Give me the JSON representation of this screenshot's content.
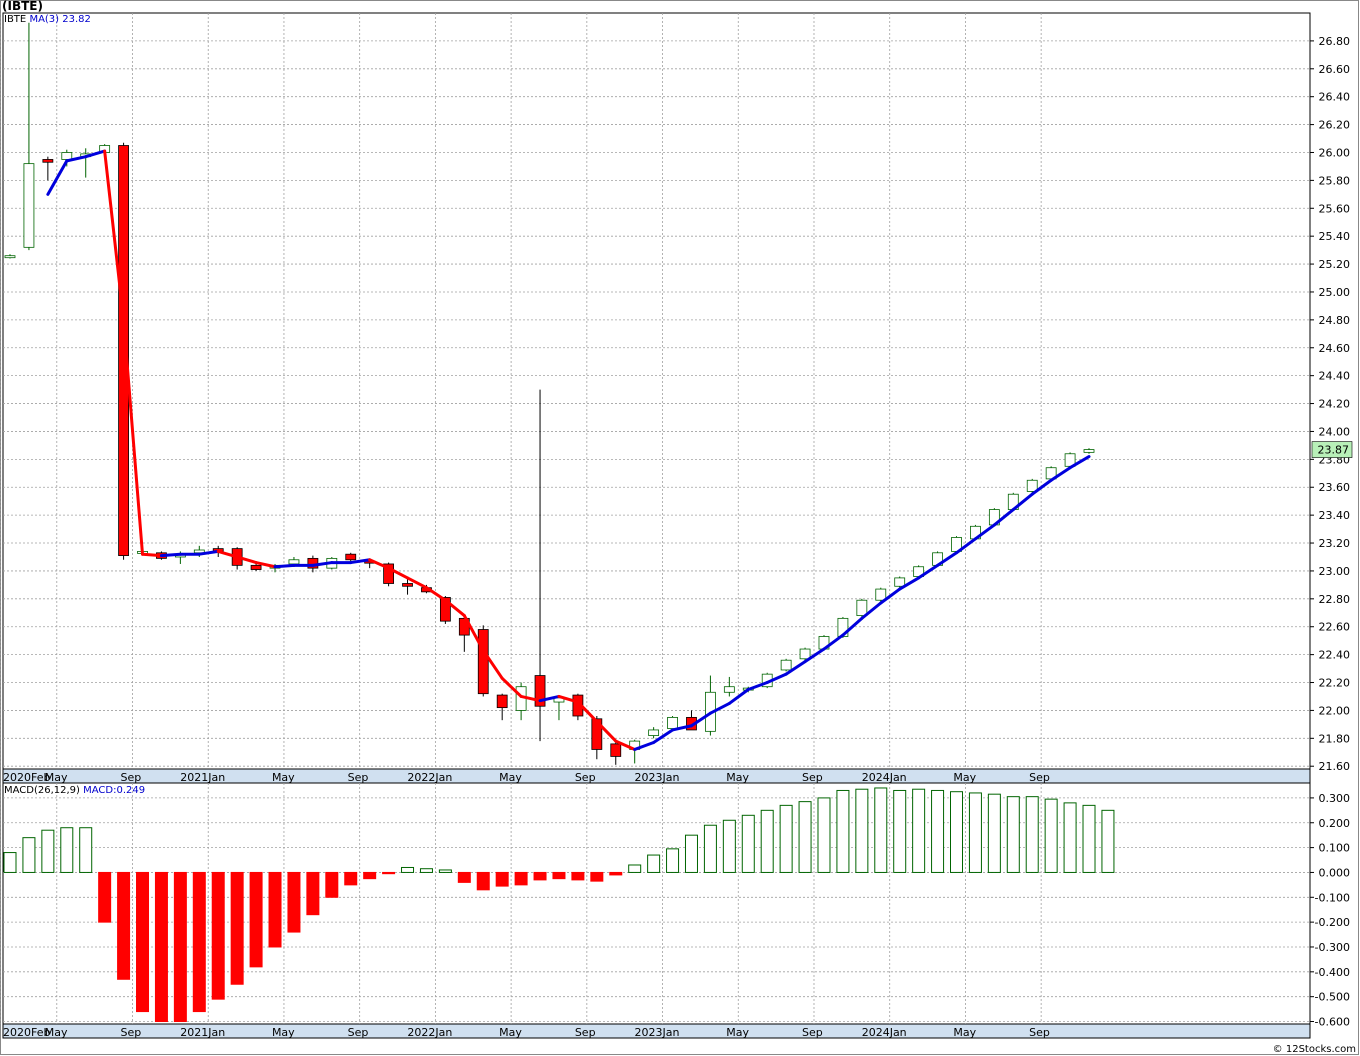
{
  "header": {
    "title": "(IBTE)"
  },
  "legend": {
    "price_ticker": "IBTE",
    "ma_label": "MA(3)",
    "ma_value": "23.82",
    "macd_params": "MACD(26,12,9)",
    "macd_value": "MACD:0.249"
  },
  "credit": "© 12Stocks.com",
  "colors": {
    "up": "#ffffff",
    "up_border": "#006400",
    "down": "#ff0000",
    "ma_up": "#0000dd",
    "ma_down": "#ff0000",
    "grid": "#a0a0a0",
    "axis_band": "#d0e0f0",
    "last_price_bg": "#b8f0b8"
  },
  "chart_data": [
    {
      "type": "candlestick",
      "title": "(IBTE)",
      "ylim": [
        21.58,
        27.0
      ],
      "y_ticks": [
        "21.60",
        "21.80",
        "22.00",
        "22.20",
        "22.40",
        "22.60",
        "22.80",
        "23.00",
        "23.20",
        "23.40",
        "23.60",
        "23.80",
        "24.00",
        "24.20",
        "24.40",
        "24.60",
        "24.80",
        "25.00",
        "25.20",
        "25.40",
        "25.60",
        "25.80",
        "26.00",
        "26.20",
        "26.40",
        "26.60",
        "26.80"
      ],
      "x_tick_labels": [
        "2020Feb",
        "May",
        "Sep",
        "2021Jan",
        "May",
        "Sep",
        "2022Jan",
        "May",
        "Sep",
        "2023Jan",
        "May",
        "Sep",
        "2024Jan",
        "May",
        "Sep"
      ],
      "last_price": "23.87",
      "candles": [
        {
          "o": 25.25,
          "h": 25.27,
          "l": 25.24,
          "c": 25.26
        },
        {
          "o": 25.32,
          "h": 26.93,
          "l": 25.3,
          "c": 25.92
        },
        {
          "o": 25.95,
          "h": 25.97,
          "l": 25.8,
          "c": 25.93
        },
        {
          "o": 25.95,
          "h": 26.02,
          "l": 25.9,
          "c": 26.0
        },
        {
          "o": 25.97,
          "h": 26.03,
          "l": 25.82,
          "c": 25.99
        },
        {
          "o": 26.0,
          "h": 26.06,
          "l": 25.98,
          "c": 26.05
        },
        {
          "o": 26.05,
          "h": 26.07,
          "l": 23.08,
          "c": 23.11
        },
        {
          "o": 23.14,
          "h": 23.15,
          "l": 23.12,
          "c": 23.14
        },
        {
          "o": 23.13,
          "h": 23.14,
          "l": 23.08,
          "c": 23.09
        },
        {
          "o": 23.1,
          "h": 23.14,
          "l": 23.05,
          "c": 23.12
        },
        {
          "o": 23.13,
          "h": 23.18,
          "l": 23.1,
          "c": 23.15
        },
        {
          "o": 23.16,
          "h": 23.18,
          "l": 23.1,
          "c": 23.14
        },
        {
          "o": 23.16,
          "h": 23.17,
          "l": 23.01,
          "c": 23.04
        },
        {
          "o": 23.04,
          "h": 23.05,
          "l": 23.0,
          "c": 23.01
        },
        {
          "o": 23.02,
          "h": 23.05,
          "l": 22.99,
          "c": 23.04
        },
        {
          "o": 23.05,
          "h": 23.1,
          "l": 23.03,
          "c": 23.08
        },
        {
          "o": 23.09,
          "h": 23.11,
          "l": 22.99,
          "c": 23.02
        },
        {
          "o": 23.02,
          "h": 23.1,
          "l": 23.01,
          "c": 23.09
        },
        {
          "o": 23.12,
          "h": 23.13,
          "l": 23.06,
          "c": 23.08
        },
        {
          "o": 23.07,
          "h": 23.08,
          "l": 23.02,
          "c": 23.06
        },
        {
          "o": 23.05,
          "h": 23.06,
          "l": 22.89,
          "c": 22.91
        },
        {
          "o": 22.91,
          "h": 22.94,
          "l": 22.83,
          "c": 22.89
        },
        {
          "o": 22.88,
          "h": 22.9,
          "l": 22.84,
          "c": 22.85
        },
        {
          "o": 22.81,
          "h": 22.82,
          "l": 22.62,
          "c": 22.64
        },
        {
          "o": 22.66,
          "h": 22.68,
          "l": 22.42,
          "c": 22.54
        },
        {
          "o": 22.58,
          "h": 22.61,
          "l": 22.1,
          "c": 22.12
        },
        {
          "o": 22.11,
          "h": 22.12,
          "l": 21.93,
          "c": 22.02
        },
        {
          "o": 22.0,
          "h": 22.2,
          "l": 21.93,
          "c": 22.17
        },
        {
          "o": 22.25,
          "h": 24.3,
          "l": 21.78,
          "c": 22.03
        },
        {
          "o": 22.06,
          "h": 22.11,
          "l": 21.93,
          "c": 22.09
        },
        {
          "o": 22.11,
          "h": 22.12,
          "l": 21.93,
          "c": 21.96
        },
        {
          "o": 21.94,
          "h": 21.96,
          "l": 21.65,
          "c": 21.72
        },
        {
          "o": 21.76,
          "h": 21.78,
          "l": 21.61,
          "c": 21.67
        },
        {
          "o": 21.72,
          "h": 21.79,
          "l": 21.62,
          "c": 21.78
        },
        {
          "o": 21.82,
          "h": 21.88,
          "l": 21.8,
          "c": 21.86
        },
        {
          "o": 21.87,
          "h": 21.96,
          "l": 21.86,
          "c": 21.95
        },
        {
          "o": 21.95,
          "h": 22.0,
          "l": 21.86,
          "c": 21.86
        },
        {
          "o": 21.85,
          "h": 22.25,
          "l": 21.82,
          "c": 22.13
        },
        {
          "o": 22.13,
          "h": 22.24,
          "l": 22.1,
          "c": 22.17
        },
        {
          "o": 22.15,
          "h": 22.17,
          "l": 22.13,
          "c": 22.16
        },
        {
          "o": 22.17,
          "h": 22.27,
          "l": 22.16,
          "c": 22.26
        },
        {
          "o": 22.29,
          "h": 22.37,
          "l": 22.28,
          "c": 22.36
        },
        {
          "o": 22.37,
          "h": 22.45,
          "l": 22.36,
          "c": 22.44
        },
        {
          "o": 22.44,
          "h": 22.54,
          "l": 22.43,
          "c": 22.53
        },
        {
          "o": 22.53,
          "h": 22.67,
          "l": 22.52,
          "c": 22.66
        },
        {
          "o": 22.68,
          "h": 22.8,
          "l": 22.67,
          "c": 22.79
        },
        {
          "o": 22.79,
          "h": 22.88,
          "l": 22.78,
          "c": 22.87
        },
        {
          "o": 22.89,
          "h": 22.96,
          "l": 22.88,
          "c": 22.95
        },
        {
          "o": 22.96,
          "h": 23.04,
          "l": 22.95,
          "c": 23.03
        },
        {
          "o": 23.04,
          "h": 23.14,
          "l": 23.03,
          "c": 23.13
        },
        {
          "o": 23.14,
          "h": 23.25,
          "l": 23.13,
          "c": 23.24
        },
        {
          "o": 23.23,
          "h": 23.33,
          "l": 23.22,
          "c": 23.32
        },
        {
          "o": 23.33,
          "h": 23.45,
          "l": 23.32,
          "c": 23.44
        },
        {
          "o": 23.44,
          "h": 23.56,
          "l": 23.43,
          "c": 23.55
        },
        {
          "o": 23.57,
          "h": 23.66,
          "l": 23.56,
          "c": 23.65
        },
        {
          "o": 23.66,
          "h": 23.75,
          "l": 23.65,
          "c": 23.74
        },
        {
          "o": 23.75,
          "h": 23.85,
          "l": 23.74,
          "c": 23.84
        },
        {
          "o": 23.85,
          "h": 23.88,
          "l": 23.84,
          "c": 23.87
        }
      ],
      "ma3": [
        null,
        null,
        25.7,
        25.94,
        25.97,
        26.01,
        24.8,
        23.12,
        23.11,
        23.12,
        23.12,
        23.14,
        23.1,
        23.06,
        23.03,
        23.04,
        23.04,
        23.06,
        23.06,
        23.08,
        23.02,
        22.95,
        22.88,
        22.79,
        22.68,
        22.43,
        22.23,
        22.1,
        22.07,
        22.1,
        22.06,
        21.92,
        21.78,
        21.72,
        21.77,
        21.86,
        21.89,
        21.98,
        22.05,
        22.15,
        22.2,
        22.26,
        22.35,
        22.44,
        22.54,
        22.66,
        22.77,
        22.87,
        22.95,
        23.04,
        23.13,
        23.23,
        23.33,
        23.44,
        23.55,
        23.65,
        23.74,
        23.82
      ]
    },
    {
      "type": "bar",
      "title": "MACD(26,12,9)",
      "ylim": [
        -0.61,
        0.36
      ],
      "y_ticks": [
        "0.300",
        "0.200",
        "0.100",
        "0.000",
        "-0.100",
        "-0.200",
        "-0.300",
        "-0.400",
        "-0.500",
        "-0.600"
      ],
      "x_tick_labels": [
        "2020Feb",
        "May",
        "Sep",
        "2021Jan",
        "May",
        "Sep",
        "2022Jan",
        "May",
        "Sep",
        "2023Jan",
        "May",
        "Sep",
        "2024Jan",
        "May",
        "Sep"
      ],
      "values": [
        0.08,
        0.14,
        0.17,
        0.18,
        0.18,
        -0.2,
        -0.43,
        -0.56,
        -0.6,
        -0.6,
        -0.56,
        -0.51,
        -0.45,
        -0.38,
        -0.3,
        -0.24,
        -0.17,
        -0.1,
        -0.05,
        -0.025,
        -0.005,
        0.02,
        0.015,
        0.01,
        -0.04,
        -0.07,
        -0.055,
        -0.05,
        -0.03,
        -0.025,
        -0.03,
        -0.035,
        -0.01,
        0.03,
        0.07,
        0.095,
        0.15,
        0.19,
        0.21,
        0.23,
        0.25,
        0.27,
        0.285,
        0.3,
        0.33,
        0.335,
        0.34,
        0.33,
        0.335,
        0.33,
        0.325,
        0.32,
        0.315,
        0.305,
        0.305,
        0.295,
        0.28,
        0.27,
        0.25
      ]
    }
  ]
}
